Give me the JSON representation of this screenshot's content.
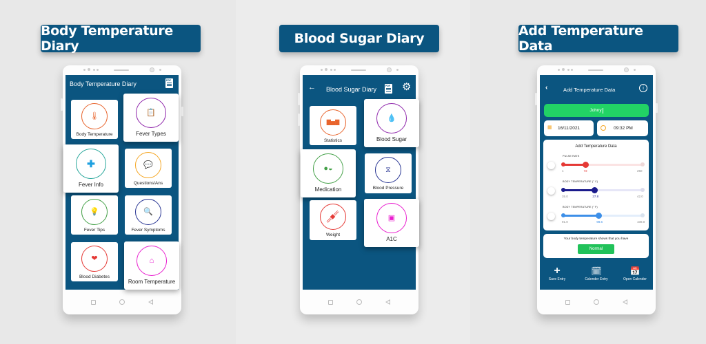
{
  "colors": {
    "brand": "#0b5580",
    "green": "#22d365",
    "background": "#e9e9e9"
  },
  "panels": [
    {
      "banner": "Body Temperature Diary",
      "screen_title": "Body Temperature Diary",
      "header_icons": [
        "pdf-icon"
      ],
      "cards": [
        {
          "label": "Body Temperature",
          "icon": "thermometer-icon",
          "color": "#e8642c"
        },
        {
          "label": "Fever Types",
          "icon": "clipboard-icon",
          "color": "#8e24aa"
        },
        {
          "label": "Fever Info",
          "icon": "medical-document-icon",
          "color": "#26a69a"
        },
        {
          "label": "Questions/Ans",
          "icon": "chat-bubbles-icon",
          "color": "#f5a623"
        },
        {
          "label": "Fever Tips",
          "icon": "lightbulb-icon",
          "color": "#43a047"
        },
        {
          "label": "Fever Symptoms",
          "icon": "virus-search-icon",
          "color": "#283593"
        },
        {
          "label": "Blood Diabetes",
          "icon": "heart-icon",
          "color": "#e53935"
        },
        {
          "label": "Room Temperature",
          "icon": "house-icon",
          "color": "#e91ecf"
        }
      ]
    },
    {
      "banner": "Blood Sugar Diary",
      "screen_title": "Blood Sugar Diary",
      "header_icons": [
        "back-arrow-icon",
        "pdf-icon",
        "gear-icon"
      ],
      "cards": [
        {
          "label": "Statistics",
          "icon": "bar-chart-icon",
          "color": "#e8642c"
        },
        {
          "label": "Blood Sugar",
          "icon": "blood-drop-icon",
          "color": "#8e24aa"
        },
        {
          "label": "Medication",
          "icon": "pills-icon",
          "color": "#43a047"
        },
        {
          "label": "Blood Pressure",
          "icon": "bp-monitor-icon",
          "color": "#283593"
        },
        {
          "label": "Weight",
          "icon": "dumbbell-icon",
          "color": "#e53935"
        },
        {
          "label": "A1C",
          "icon": "glucometer-icon",
          "color": "#e91ecf"
        }
      ]
    },
    {
      "banner": "Add Temperature Data",
      "screen_title": "Add Temperature  Data",
      "name_value": "Johny",
      "date": "16/11/2021",
      "time": "09:32 PM",
      "card_title": "Add Temperature Data",
      "sliders": [
        {
          "label": "PULSE RATE",
          "min": "1",
          "value": "72",
          "max": "250",
          "fraction": 0.29,
          "color": "#e53935",
          "track": "#fbe3e3"
        },
        {
          "label": "BODY TEMPERATURE (° C)",
          "min": "35.0",
          "value": "37.8",
          "max": "42.0",
          "fraction": 0.4,
          "color": "#1a1a8c",
          "track": "#e6e6f7"
        },
        {
          "label": "BODY TEMPERATURE (° F)",
          "min": "91.0",
          "value": "98.6",
          "max": "108.0",
          "fraction": 0.45,
          "color": "#3d8fe8",
          "track": "#e3eefb"
        }
      ],
      "result_text": "Your body temperature shows that you have",
      "result_badge": "Normal",
      "actions": [
        {
          "label": "Save Entry",
          "icon": "plus-icon"
        },
        {
          "label": "Calender Entry",
          "icon": "calendar-clock-icon"
        },
        {
          "label": "Open Calender",
          "icon": "calendar-icon"
        }
      ]
    }
  ]
}
